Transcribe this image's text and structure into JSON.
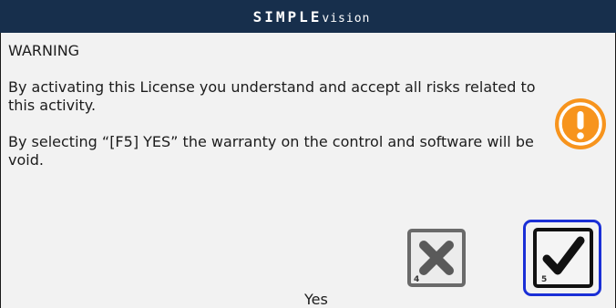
{
  "window": {
    "brand_strong": "SIMPLE",
    "brand_light": "vision"
  },
  "message": {
    "heading": "WARNING",
    "paragraph1": "By activating this License you understand and accept all risks related to this activity.",
    "paragraph2": "By selecting “[F5] YES” the warranty on the control and software will be void."
  },
  "icons": {
    "warning": "exclamation-circle-icon",
    "cancel": "x-icon",
    "confirm": "checkmark-icon"
  },
  "buttons": {
    "cancel_key": "4",
    "confirm_key": "5"
  },
  "footer": {
    "label": "Yes"
  },
  "colors": {
    "title_bar": "#172f4c",
    "background": "#f2f2f2",
    "warning_orange": "#f7941d",
    "focus_border": "#1a2fd6"
  }
}
